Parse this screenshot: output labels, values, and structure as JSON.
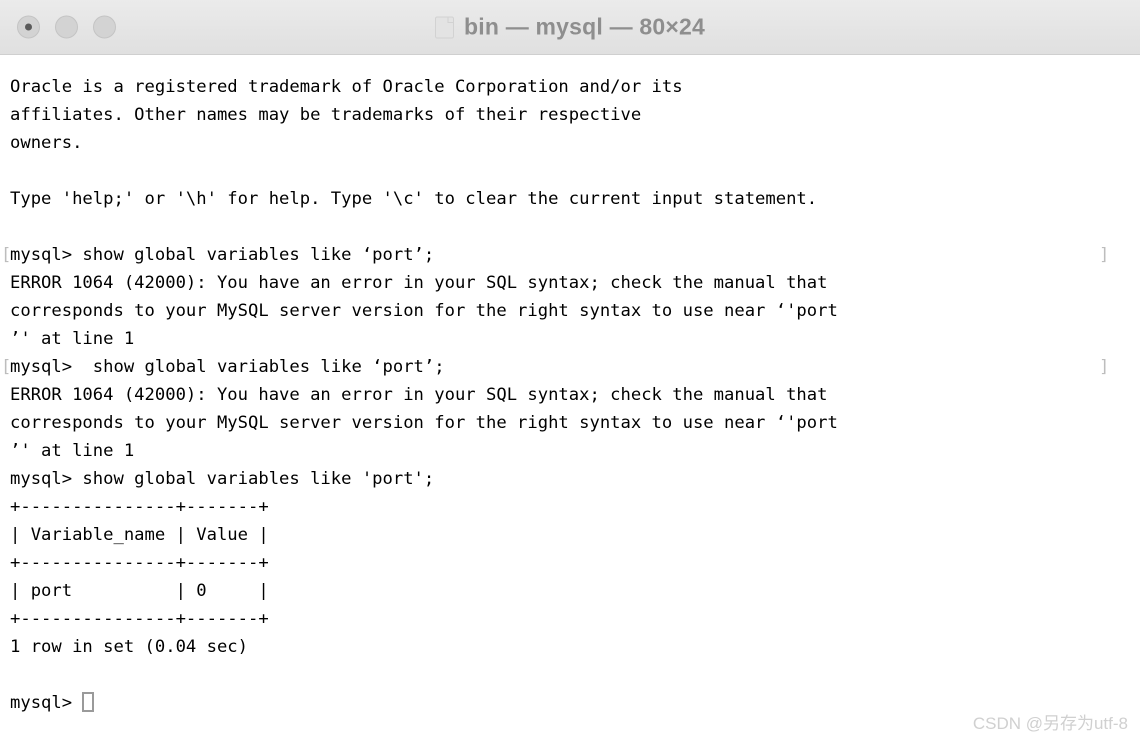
{
  "window": {
    "title": "bin — mysql — 80×24",
    "folder_icon": "folder-icon",
    "titlebar_color": "#e4e4e4",
    "title_text_color": "#8e8e8e",
    "background_color": "#ffffff",
    "traffic_lights": [
      {
        "name": "close-button",
        "color": "#d3d3d3",
        "has_dot": true
      },
      {
        "name": "minimize-button",
        "color": "#d3d3d3",
        "has_dot": false
      },
      {
        "name": "maximize-button",
        "color": "#d3d3d3",
        "has_dot": false
      }
    ]
  },
  "terminal": {
    "columns": 80,
    "rows": 24,
    "text_color": "#000000",
    "marker_color": "#bdbdbd",
    "lines": [
      {
        "text": "Oracle is a registered trademark of Oracle Corporation and/or its",
        "prompt": false
      },
      {
        "text": "affiliates. Other names may be trademarks of their respective",
        "prompt": false
      },
      {
        "text": "owners.",
        "prompt": false
      },
      {
        "text": "",
        "prompt": false
      },
      {
        "text": "Type 'help;' or '\\h' for help. Type '\\c' to clear the current input statement.",
        "prompt": false
      },
      {
        "text": "",
        "prompt": false
      },
      {
        "text": "mysql> show global variables like ‘port’;",
        "prompt": true
      },
      {
        "text": "ERROR 1064 (42000): You have an error in your SQL syntax; check the manual that",
        "prompt": false
      },
      {
        "text": "corresponds to your MySQL server version for the right syntax to use near ‘'port",
        "prompt": false
      },
      {
        "text": "’' at line 1",
        "prompt": false
      },
      {
        "text": "mysql>  show global variables like ‘port’;",
        "prompt": true
      },
      {
        "text": "ERROR 1064 (42000): You have an error in your SQL syntax; check the manual that",
        "prompt": false
      },
      {
        "text": "corresponds to your MySQL server version for the right syntax to use near ‘'port",
        "prompt": false
      },
      {
        "text": "’' at line 1",
        "prompt": false
      },
      {
        "text": "mysql> show global variables like 'port';",
        "prompt": false
      },
      {
        "text": "+---------------+-------+",
        "prompt": false
      },
      {
        "text": "| Variable_name | Value |",
        "prompt": false
      },
      {
        "text": "+---------------+-------+",
        "prompt": false
      },
      {
        "text": "| port          | 0     |",
        "prompt": false
      },
      {
        "text": "+---------------+-------+",
        "prompt": false
      },
      {
        "text": "1 row in set (0.04 sec)",
        "prompt": false
      },
      {
        "text": "",
        "prompt": false
      },
      {
        "text": "mysql> ",
        "prompt": false,
        "cursor": true
      }
    ],
    "result_table": {
      "headers": [
        "Variable_name",
        "Value"
      ],
      "rows": [
        [
          "port",
          "0"
        ]
      ],
      "row_count_text": "1 row in set (0.04 sec)"
    },
    "prompt_marker_open": "[",
    "prompt_marker_close": "]"
  },
  "watermark": {
    "text": "CSDN @另存为utf-8",
    "color": "#d0d0d0"
  }
}
